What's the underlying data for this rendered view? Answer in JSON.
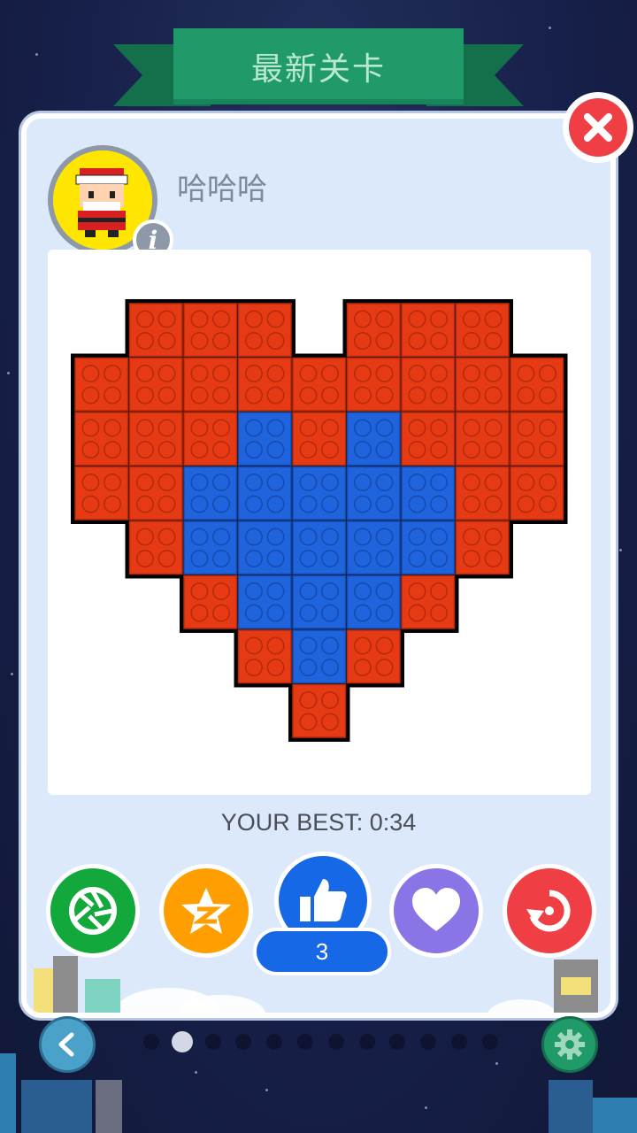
{
  "header": {
    "title": "最新关卡"
  },
  "profile": {
    "username": "哈哈哈",
    "avatar_icon": "santa-pixel-avatar",
    "info_icon": "info-icon"
  },
  "artwork": {
    "description": "pixel heart built from toy bricks",
    "colors": {
      "red": "#e63a14",
      "blue": "#1f63dd"
    },
    "grid": [
      ".RRR.RRR.",
      "RRRRRRRRR",
      "RRRBRBRRR",
      "RRBBBBBRR",
      ".RBBBBBR.",
      "..RBBBR..",
      "...RBR...",
      "....R...."
    ]
  },
  "stats": {
    "best_label": "YOUR BEST: 0:34",
    "likes": "3"
  },
  "actions": [
    {
      "name": "moments-share-button",
      "icon": "camera-aperture-icon",
      "color": "#13a83b"
    },
    {
      "name": "qzone-share-button",
      "icon": "qzone-star-icon",
      "color": "#ff9e00"
    },
    {
      "name": "like-button",
      "icon": "thumbs-up-icon",
      "color": "#1668e6"
    },
    {
      "name": "favorite-button",
      "icon": "heart-icon",
      "color": "#8a74e6"
    },
    {
      "name": "replay-button",
      "icon": "replay-icon",
      "color": "#ef3f45"
    }
  ],
  "pagination": {
    "total": 12,
    "current": 2
  },
  "nav": {
    "back_icon": "chevron-left-icon",
    "settings_icon": "gear-icon"
  }
}
